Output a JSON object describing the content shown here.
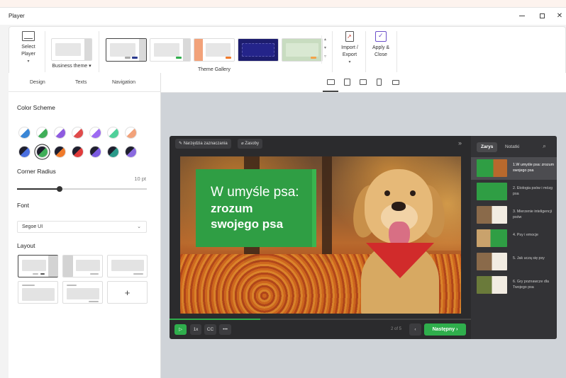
{
  "window": {
    "title": "Player"
  },
  "ribbon": {
    "select_player": "Select Player",
    "business_theme": "Business theme",
    "gallery_label": "Theme Gallery",
    "import_export": "Import / Export",
    "apply_close": "Apply & Close",
    "themes": [
      {
        "name": "theme-1",
        "accent": "#2b3a8f",
        "selected": true
      },
      {
        "name": "theme-2",
        "accent": "#2fae4c"
      },
      {
        "name": "theme-3",
        "accent": "#f2a27a"
      },
      {
        "name": "theme-4",
        "accent": "#1d1d6e"
      },
      {
        "name": "theme-5",
        "accent": "#c8dcc0"
      }
    ]
  },
  "left_panel": {
    "tabs": [
      "Design",
      "Texts",
      "Navigation"
    ],
    "color_scheme_title": "Color Scheme",
    "corner_radius_title": "Corner Radius",
    "corner_radius_value": "10 pt",
    "corner_radius_level": 0.33,
    "font_title": "Font",
    "font_value": "Segoe UI",
    "layout_title": "Layout",
    "swatches_row1": [
      "#3a86d6",
      "#3fae58",
      "#8e5be0",
      "#e04b4b",
      "#9d6af2",
      "#4fd09a",
      "#f2a27a"
    ],
    "swatches_row2": [
      "#4a6fe0",
      "#3fae58",
      "#f07a2a",
      "#e03b3b",
      "#7a5ae0",
      "#2a9a8a",
      "#8a6ae0"
    ]
  },
  "player": {
    "toolbar_annotations": "Narzędzia zaznaczania",
    "toolbar_resources": "Zasoby",
    "slide_title_line1": "W umyśle psa:",
    "slide_title_line2": "zrozum",
    "slide_title_line3": "swojego psa",
    "progress": 0.3,
    "speed": "1x",
    "captions": "CC",
    "more": "•••",
    "page_counter": "2 of 5",
    "next": "Następny",
    "sidebar_tabs": [
      "Zarys",
      "Notatki"
    ],
    "outline": [
      {
        "label": "1.W umyśle psa: zrozum swojego psa",
        "active": true
      },
      {
        "label": "2. Etologia psów i mózg psa"
      },
      {
        "label": "3. Mierzenie inteligencji psów"
      },
      {
        "label": "4. Psy i emocje"
      },
      {
        "label": "5. Jak uczą się psy"
      },
      {
        "label": "6. Gry poznawcze dla Twojego psa"
      }
    ]
  }
}
